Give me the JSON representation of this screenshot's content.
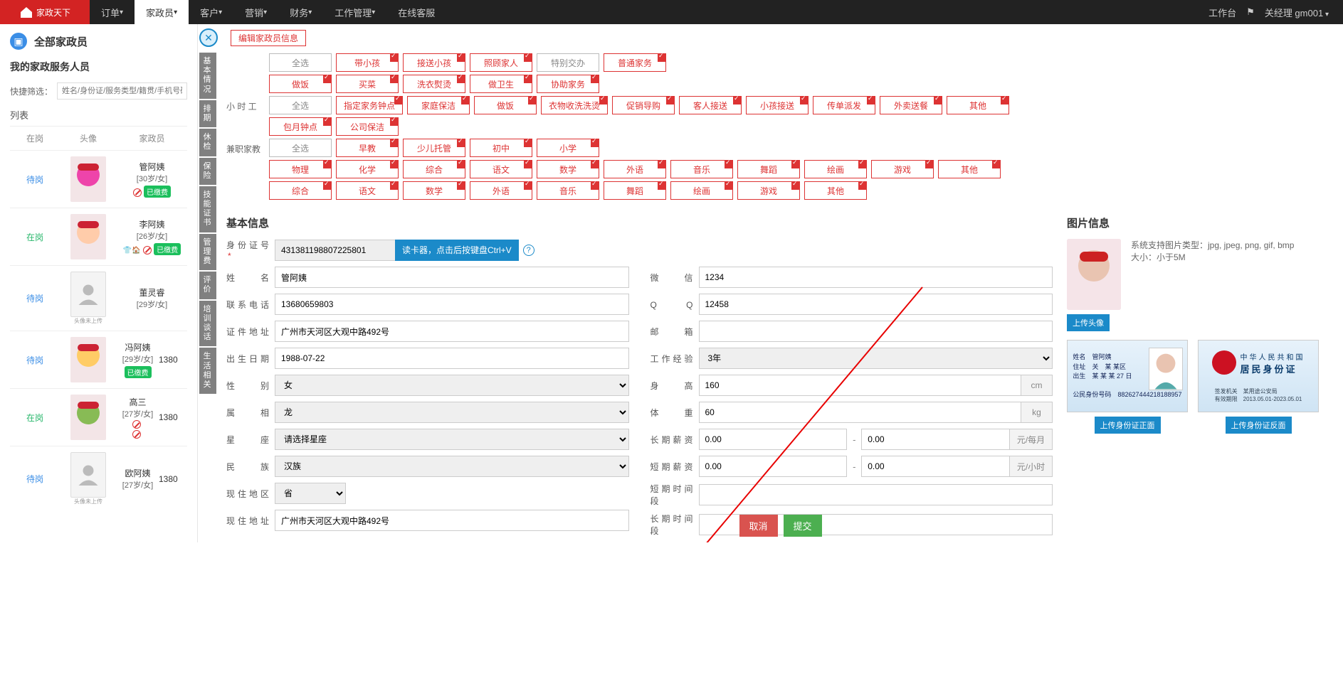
{
  "nav": {
    "items": [
      "订单",
      "家政员",
      "客户",
      "营销",
      "财务",
      "工作管理",
      "在线客服"
    ],
    "activeIndex": 1,
    "right": {
      "workbench": "工作台",
      "user": "关经理  gm001"
    }
  },
  "left": {
    "title": "全部家政员",
    "subtitle": "我的家政服务人员",
    "filterLabel": "快捷筛选：",
    "filterPlaceholder": "姓名/身份证/服务类型/籍贯/手机号码筛",
    "listLabel": "列表",
    "cols": [
      "在岗",
      "头像",
      "家政员"
    ],
    "rows": [
      {
        "status": "待岗",
        "statusCls": "status-wait",
        "name": "管阿姨",
        "sub": "[30岁/女]",
        "paid": true,
        "forbid": true,
        "ph": "c1"
      },
      {
        "status": "在岗",
        "statusCls": "status-on",
        "name": "李阿姨",
        "sub": "[26岁/女]",
        "paid": true,
        "forbid": true,
        "ph": "c2",
        "icons": true
      },
      {
        "status": "待岗",
        "statusCls": "status-wait",
        "name": "董灵睿",
        "sub": "[29岁/女]",
        "missing": true
      },
      {
        "status": "待岗",
        "statusCls": "status-wait",
        "name": "冯阿姨",
        "sub": "[29岁/女]",
        "paid": true,
        "ph": "c3",
        "extra": "1380"
      },
      {
        "status": "在岗",
        "statusCls": "status-on",
        "name": "高三",
        "sub": "[27岁/女]",
        "forbid": true,
        "ph": "c4",
        "extra": "1380"
      },
      {
        "status": "待岗",
        "statusCls": "status-wait",
        "name": "欧阿姨",
        "sub": "[27岁/女]",
        "missing": true,
        "extra": "1380"
      }
    ]
  },
  "sideTabs": [
    "基本情况",
    "排期",
    "休检",
    "保险",
    "技能证书",
    "管理费",
    "评价",
    "培训谈话",
    "生活相关"
  ],
  "editTitle": "编辑家政员信息",
  "tagGroups": [
    {
      "label": "",
      "all": "全选",
      "tags": [
        "带小孩",
        "接送小孩",
        "照顾家人",
        "普通家务"
      ],
      "plain": [
        3
      ],
      "plainText": "特别交办"
    },
    {
      "label": "",
      "tags": [
        "做饭",
        "买菜",
        "洗衣熨烫",
        "做卫生",
        "协助家务"
      ]
    },
    {
      "label": "小 时 工",
      "all": "全选",
      "tags": [
        "指定家务钟点",
        "家庭保洁",
        "做饭",
        "衣物收洗洗烫",
        "促销导购",
        "客人接送",
        "小孩接送",
        "传单派发",
        "外卖送餐",
        "其他"
      ]
    },
    {
      "label": "",
      "tags": [
        "包月钟点",
        "公司保洁"
      ]
    },
    {
      "label": "兼职家教",
      "all": "全选",
      "tags": [
        "早教",
        "少儿托管",
        "初中",
        "小学"
      ]
    },
    {
      "label": "",
      "tags": [
        "物理",
        "化学",
        "综合",
        "语文",
        "数学",
        "外语",
        "音乐",
        "舞蹈",
        "绘画",
        "游戏",
        "其他"
      ]
    },
    {
      "label": "",
      "tags": [
        "综合",
        "语文",
        "数学",
        "外语",
        "音乐",
        "舞蹈",
        "绘画",
        "游戏",
        "其他"
      ]
    }
  ],
  "sectionBasic": "基本信息",
  "form": {
    "idLabel": "身份证号",
    "idValue": "431381198807225801",
    "readCard": "读卡器，点击后按键盘Ctrl+V",
    "nameL": "姓　　名",
    "nameV": "管阿姨",
    "wechatL": "微　　信",
    "wechatV": "1234",
    "phoneL": "联系电话",
    "phoneV": "13680659803",
    "qqL": "Q　　Q",
    "qqV": "12458",
    "addrL": "证件地址",
    "addrV": "广州市天河区大观中路492号",
    "mailL": "邮　　箱",
    "mailV": "",
    "birthL": "出生日期",
    "birthV": "1988-07-22",
    "expL": "工作经验",
    "expV": "3年",
    "genderL": "性　　别",
    "genderV": "女",
    "heightL": "身　　高",
    "heightV": "160",
    "heightU": "cm",
    "zodiacL": "属　　相",
    "zodiacV": "龙",
    "weightL": "体　　重",
    "weightV": "60",
    "weightU": "kg",
    "starL": "星　　座",
    "starV": "请选择星座",
    "longSalL": "长期薪资",
    "sal0": "0.00",
    "salU1": "元/每月",
    "ethnicL": "民　　族",
    "ethnicV": "汉族",
    "shortSalL": "短期薪资",
    "salU2": "元/小时",
    "curAreaL": "现住地区",
    "curAreaV": "省",
    "shortTimeL": "短期时间段",
    "curAddrL": "现住地址",
    "curAddrV": "广州市天河区大观中路492号",
    "longTimeL": "长期时间段"
  },
  "imgPanel": {
    "title": "图片信息",
    "supported": "系统支持图片类型：jpg, jpeg, png, gif, bmp",
    "sizeNote": "大小：小于5M",
    "uploadAvatar": "上传头像",
    "uploadFront": "上传身份证正面",
    "uploadBack": "上传身份证反面",
    "idFront": {
      "name": "管阿姨",
      "addr": "关　某 某区",
      "dob": "某 某 某 27 日",
      "num": "882627444218188957",
      "label": "公民身份号码"
    },
    "idBack": {
      "l1": "中华人民共和国",
      "l2": "居民身份证",
      "org": "签发机关　某用途公安局",
      "valid": "有效期限　2013.05.01-2023.05.01"
    }
  },
  "actions": {
    "cancel": "取消",
    "submit": "提交"
  }
}
